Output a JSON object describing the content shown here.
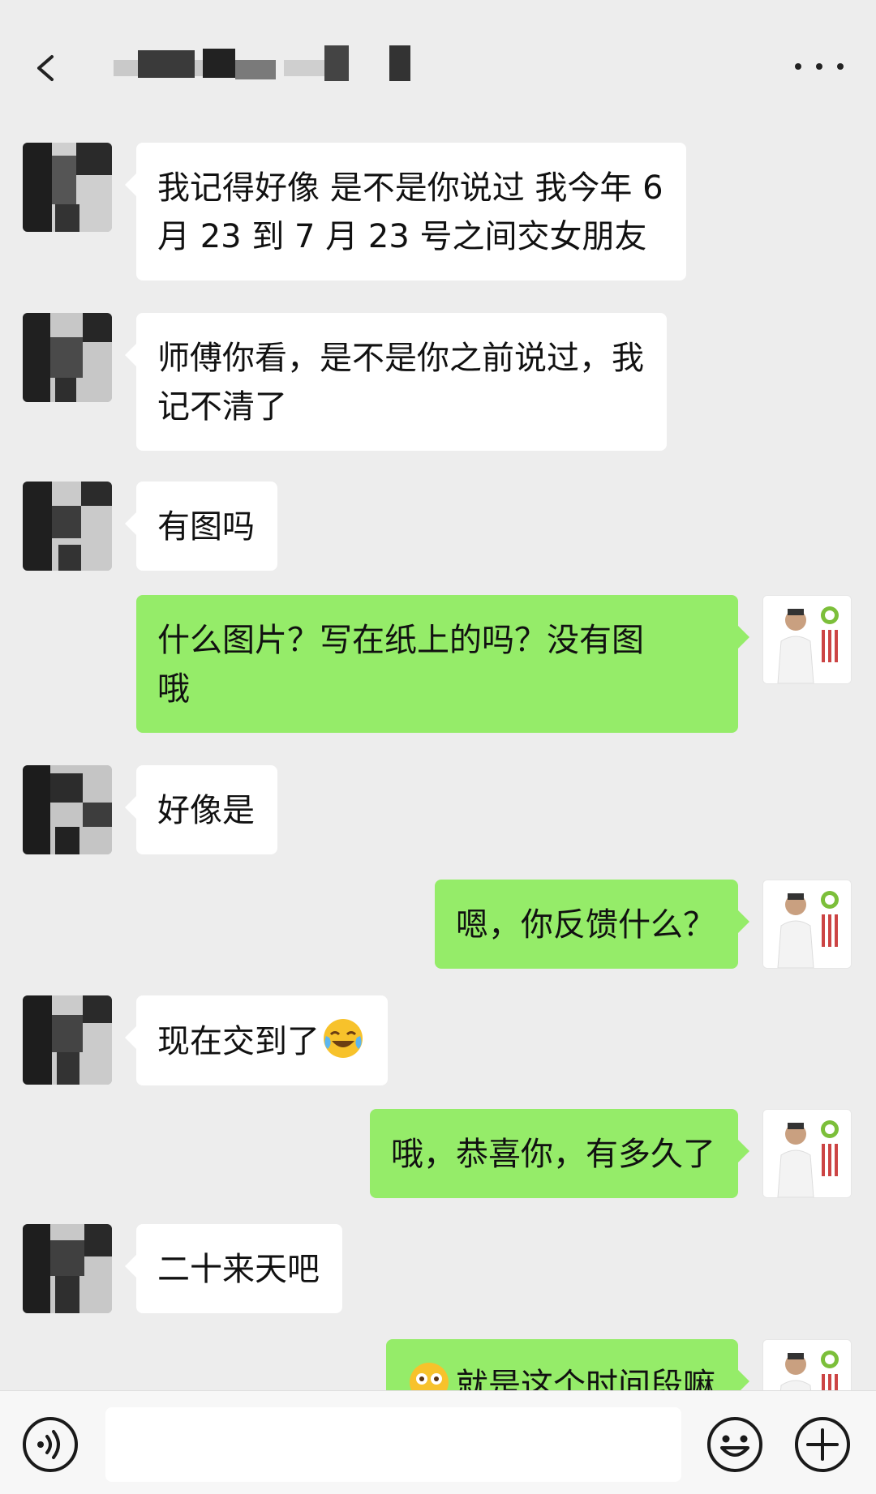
{
  "header": {
    "back_icon": "back-arrow-icon",
    "more_icon": "more-dots-icon"
  },
  "colors": {
    "background": "#ededed",
    "incoming_bubble": "#ffffff",
    "outgoing_bubble": "#95ec69",
    "bottom_bar": "#f7f7f7"
  },
  "messages": [
    {
      "side": "left",
      "lines": [
        "我记得好像 是不是你说过 我今年 6",
        "月 23 到 7 月 23 号之间交女朋友"
      ]
    },
    {
      "side": "left",
      "lines": [
        "师傅你看，是不是你之前说过，我",
        "记不清了"
      ]
    },
    {
      "side": "left",
      "lines": [
        "有图吗"
      ]
    },
    {
      "side": "right",
      "lines": [
        "什么图片？写在纸上的吗？没有图",
        "哦"
      ]
    },
    {
      "side": "left",
      "lines": [
        "好像是"
      ]
    },
    {
      "side": "right",
      "lines": [
        "嗯，你反馈什么？"
      ]
    },
    {
      "side": "left",
      "lines": [
        "现在交到了"
      ],
      "emoji": "laugh-crying-emoji"
    },
    {
      "side": "right",
      "lines": [
        "哦，恭喜你，有多久了"
      ]
    },
    {
      "side": "left",
      "lines": [
        "二十来天吧"
      ]
    },
    {
      "side": "right",
      "lines": [
        "就是这个时间段嘛"
      ],
      "emoji_before": "flushed-emoji"
    }
  ],
  "bottom_bar": {
    "voice_icon": "voice-icon",
    "emoji_icon": "emoji-smile-icon",
    "plus_icon": "plus-circle-icon"
  }
}
